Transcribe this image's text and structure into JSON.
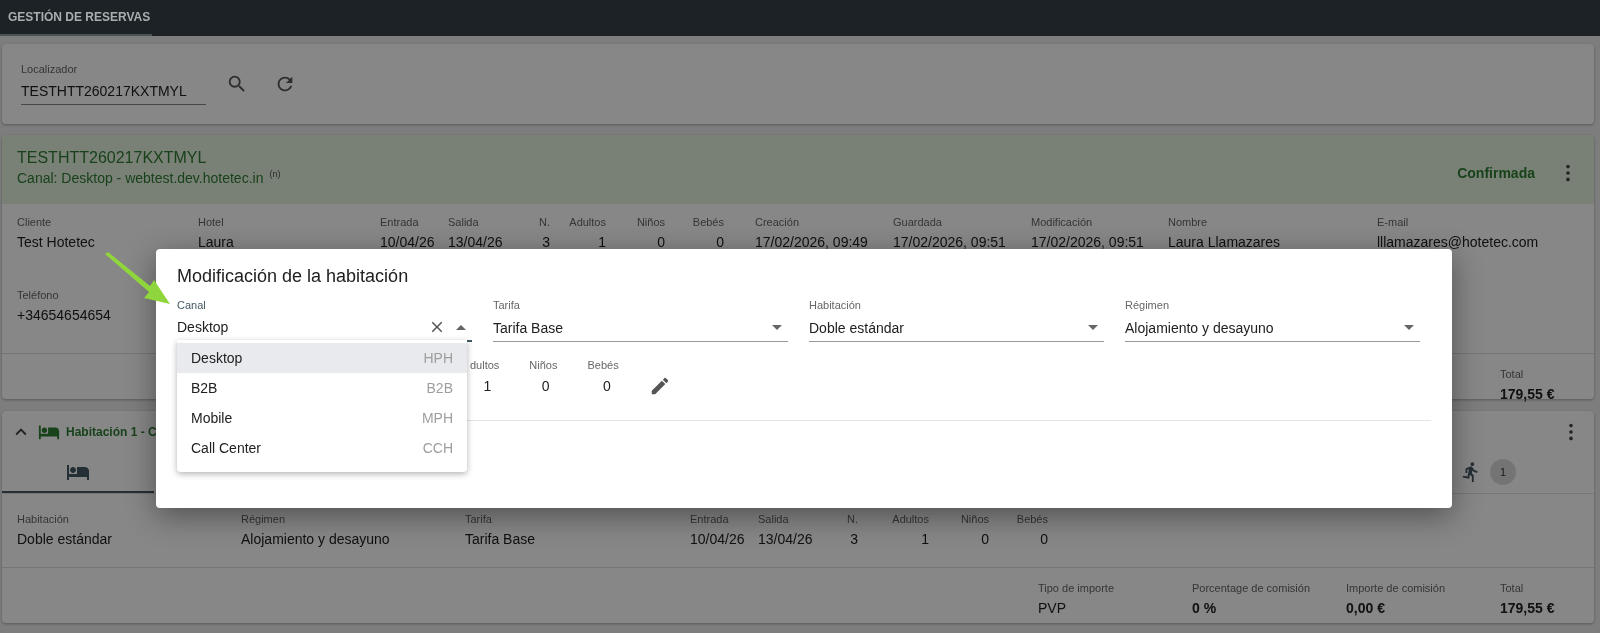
{
  "app_bar": {
    "tabs": [
      {
        "label": "GESTIÓN DE RESERVAS",
        "selected": true
      }
    ]
  },
  "search": {
    "label": "Localizador",
    "value": "TESTHTT260217KXTMYL"
  },
  "booking": {
    "locator": "TESTHTT260217KXTMYL",
    "channel": "Canal: Desktop - webtest.dev.hotetec.in",
    "note_mark": "(n)",
    "status": "Confirmada",
    "details": [
      {
        "label": "Cliente",
        "value": "Test Hotetec",
        "kind": "text"
      },
      {
        "label": "Hotel",
        "value": "Laura",
        "kind": "text"
      },
      {
        "label": "Entrada",
        "value": "10/04/26",
        "kind": "text"
      },
      {
        "label": "Salida",
        "value": "13/04/26",
        "kind": "text"
      },
      {
        "label": "N.",
        "value": "3",
        "kind": "count"
      },
      {
        "label": "Adultos",
        "value": "1",
        "kind": "count"
      },
      {
        "label": "Niños",
        "value": "0",
        "kind": "count"
      },
      {
        "label": "Bebés",
        "value": "0",
        "kind": "count"
      },
      {
        "label": "Creación",
        "value": "17/02/2026, 09:49",
        "kind": "text"
      },
      {
        "label": "Guardada",
        "value": "17/02/2026, 09:51",
        "kind": "text"
      },
      {
        "label": "Modificación",
        "value": "17/02/2026, 09:51",
        "kind": "text"
      },
      {
        "label": "Nombre",
        "value": "Laura Llamazares",
        "kind": "text"
      },
      {
        "label": "E-mail",
        "value": "lllamazares@hotetec.com",
        "kind": "text"
      }
    ],
    "contact": [
      {
        "label": "Teléfono",
        "value": "+34654654654"
      }
    ],
    "totals": [
      {
        "label": "Total",
        "value": "179,55 €",
        "kind": "amount"
      }
    ]
  },
  "room": {
    "title": "Habitación 1 - C",
    "expanded": true,
    "tabs": [
      {
        "kind": "bed",
        "selected": true
      },
      {
        "kind": "guests",
        "count": "1",
        "selected": false
      }
    ],
    "details": [
      {
        "label": "Habitación",
        "value": "Doble estándar",
        "kind": "text"
      },
      {
        "label": "Régimen",
        "value": "Alojamiento y desayuno",
        "kind": "text"
      },
      {
        "label": "Tarifa",
        "value": "Tarifa Base",
        "kind": "text"
      },
      {
        "label": "Entrada",
        "value": "10/04/26",
        "kind": "text"
      },
      {
        "label": "Salida",
        "value": "13/04/26",
        "kind": "text"
      },
      {
        "label": "N.",
        "value": "3",
        "kind": "count"
      },
      {
        "label": "Adultos",
        "value": "1",
        "kind": "count"
      },
      {
        "label": "Niños",
        "value": "0",
        "kind": "count"
      },
      {
        "label": "Bebés",
        "value": "0",
        "kind": "count"
      }
    ],
    "amounts": [
      {
        "label": "Tipo de importe",
        "value": "PVP",
        "kind": "text"
      },
      {
        "label": "Porcentage de comisión",
        "value": "0 %",
        "kind": "amount"
      },
      {
        "label": "Importe de comisión",
        "value": "0,00 €",
        "kind": "amount"
      },
      {
        "label": "Total",
        "value": "179,55 €",
        "kind": "amount"
      }
    ]
  },
  "modal": {
    "title": "Modificación de la habitación",
    "fields": [
      {
        "label": "Canal",
        "value": "Desktop",
        "open": true
      },
      {
        "label": "Tarifa",
        "value": "Tarifa Base",
        "open": false
      },
      {
        "label": "Habitación",
        "value": "Doble estándar",
        "open": false
      },
      {
        "label": "Régimen",
        "value": "Alojamiento y desayuno",
        "open": false
      }
    ],
    "options": [
      {
        "label": "Desktop",
        "code": "HPH",
        "selected": true
      },
      {
        "label": "B2B",
        "code": "B2B",
        "selected": false
      },
      {
        "label": "Mobile",
        "code": "MPH",
        "selected": false
      },
      {
        "label": "Call Center",
        "code": "CCH",
        "selected": false
      }
    ],
    "stats": [
      {
        "label": "dultos",
        "value": "1"
      },
      {
        "label": "Niños",
        "value": "0"
      },
      {
        "label": "Bebés",
        "value": "0"
      }
    ]
  }
}
